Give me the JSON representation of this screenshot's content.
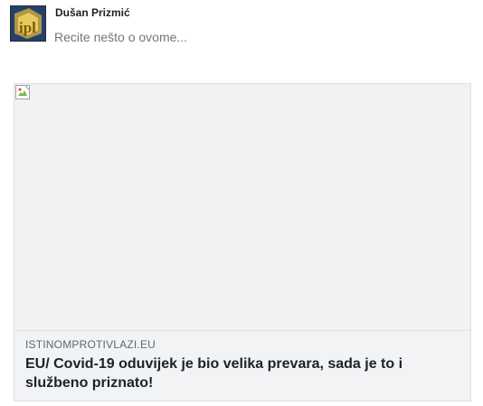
{
  "composer": {
    "author_name": "Dušan Prizmić",
    "placeholder": "Recite nešto o ovome...",
    "avatar_icon": "ipl-logo-icon"
  },
  "link_preview": {
    "image_icon": "broken-image-icon",
    "domain": "ISTINOMPROTIVLAZI.EU",
    "title": "EU/ Covid-19 oduvijek je bio velika prevara, sada je to i službeno priznato!"
  }
}
